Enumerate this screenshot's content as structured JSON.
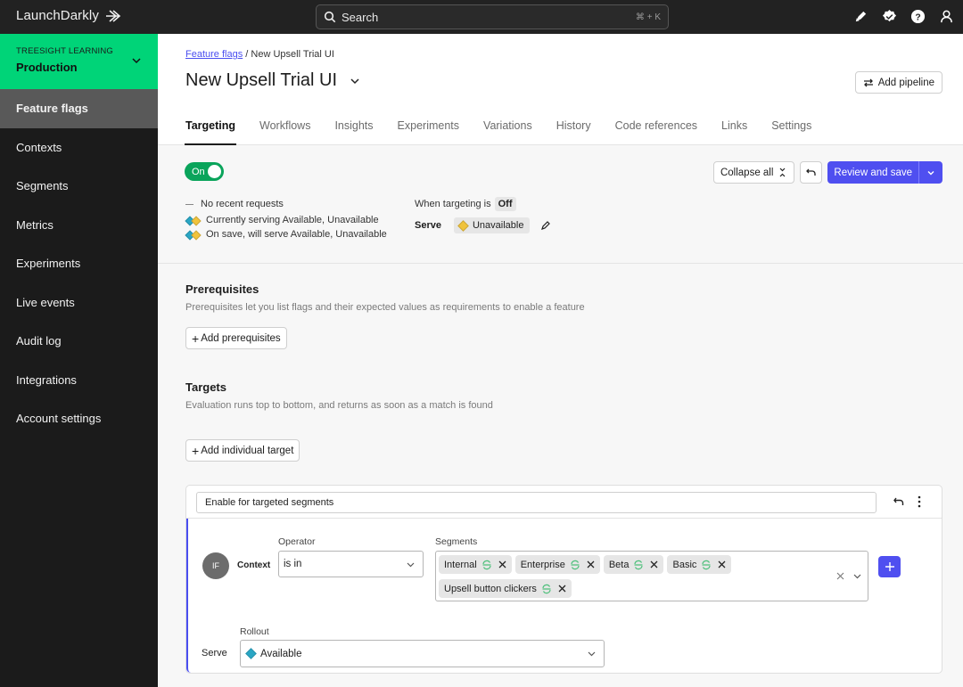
{
  "app": {
    "logo": "LaunchDarkly",
    "search": {
      "placeholder": "Search",
      "shortcut": "⌘ + K"
    },
    "top_icons": [
      "launch-icon",
      "verified-badge-icon",
      "help-icon",
      "user-icon"
    ]
  },
  "sidebar": {
    "org": "TREESIGHT LEARNING",
    "environment": "Production",
    "env_color": "#00d478",
    "items": [
      {
        "label": "Feature flags",
        "active": true
      },
      {
        "label": "Contexts"
      },
      {
        "label": "Segments"
      },
      {
        "label": "Metrics"
      },
      {
        "label": "Experiments"
      },
      {
        "label": "Live events"
      },
      {
        "label": "Audit log"
      },
      {
        "label": "Integrations"
      },
      {
        "label": "Account settings"
      }
    ]
  },
  "header": {
    "breadcrumb_link": "Feature flags",
    "breadcrumb_sep": "/",
    "breadcrumb_current": "New Upsell Trial UI",
    "title": "New Upsell Trial UI",
    "add_pipeline": "Add pipeline",
    "tabs": [
      {
        "label": "Targeting",
        "active": true
      },
      {
        "label": "Workflows"
      },
      {
        "label": "Insights"
      },
      {
        "label": "Experiments"
      },
      {
        "label": "Variations"
      },
      {
        "label": "History"
      },
      {
        "label": "Code references"
      },
      {
        "label": "Links"
      },
      {
        "label": "Settings"
      }
    ]
  },
  "status": {
    "toggle_label": "On",
    "toggle_on": true,
    "no_requests": "No recent requests",
    "currently_serving": "Currently serving Available, Unavailable",
    "on_save": "On save, will serve Available, Unavailable",
    "when_targeting": "When targeting is",
    "when_targeting_value": "Off",
    "serve_label": "Serve",
    "serve_value": "Unavailable",
    "collapse_all": "Collapse all",
    "review_and_save": "Review and save",
    "primary_color": "#4f4ff0"
  },
  "prerequisites": {
    "title": "Prerequisites",
    "description": "Prerequisites let you list flags and their expected values as requirements to enable a feature",
    "add_button": "Add prerequisites"
  },
  "targets": {
    "title": "Targets",
    "description": "Evaluation runs top to bottom, and returns as soon as a match is found",
    "add_button": "Add individual target"
  },
  "rule": {
    "name": "Enable for targeted segments",
    "if_label": "IF",
    "context_label": "Context",
    "operator_label": "Operator",
    "operator_value": "is in",
    "segments_label": "Segments",
    "segments": [
      "Internal",
      "Enterprise",
      "Beta",
      "Basic",
      "Upsell button clickers"
    ],
    "serve_label": "Serve",
    "rollout_label": "Rollout",
    "rollout_value": "Available"
  },
  "variation_colors": {
    "Available": "#2aa6c4",
    "Unavailable": "#f0c33c"
  }
}
